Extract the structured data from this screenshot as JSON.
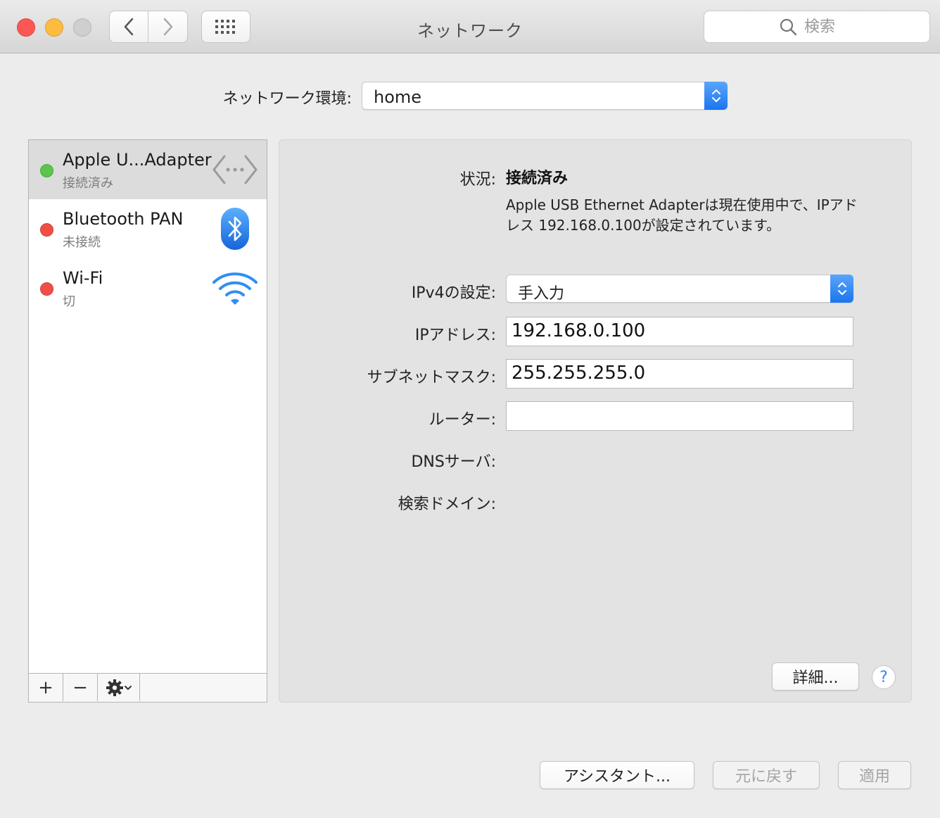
{
  "window": {
    "title": "ネットワーク",
    "search_placeholder": "検索"
  },
  "location": {
    "label": "ネットワーク環境:",
    "value": "home"
  },
  "services": [
    {
      "name": "Apple U...Adapter",
      "status": "接続済み",
      "status_color": "green",
      "icon": "ethernet-icon",
      "selected": true
    },
    {
      "name": "Bluetooth PAN",
      "status": "未接続",
      "status_color": "red",
      "icon": "bluetooth-icon",
      "selected": false
    },
    {
      "name": "Wi-Fi",
      "status": "切",
      "status_color": "red",
      "icon": "wifi-icon",
      "selected": false
    }
  ],
  "sidebar_toolbar": {
    "add": "+",
    "remove": "−"
  },
  "detail": {
    "status_label": "状況:",
    "status_value": "接続済み",
    "status_description": "Apple USB Ethernet Adapterは現在使用中で、IPアドレス 192.168.0.100が設定されています。",
    "ipv4_label": "IPv4の設定:",
    "ipv4_value": "手入力",
    "ip_label": "IPアドレス:",
    "ip_value": "192.168.0.100",
    "subnet_label": "サブネットマスク:",
    "subnet_value": "255.255.255.0",
    "router_label": "ルーター:",
    "router_value": "",
    "dns_label": "DNSサーバ:",
    "search_domain_label": "検索ドメイン:",
    "advanced_button": "詳細...",
    "help_button": "?"
  },
  "footer": {
    "assistant_button": "アシスタント...",
    "revert_button": "元に戻す",
    "apply_button": "適用"
  },
  "colors": {
    "accent": "#1b75ee",
    "connected": "#5bc54c",
    "disconnected": "#ef4f47"
  }
}
